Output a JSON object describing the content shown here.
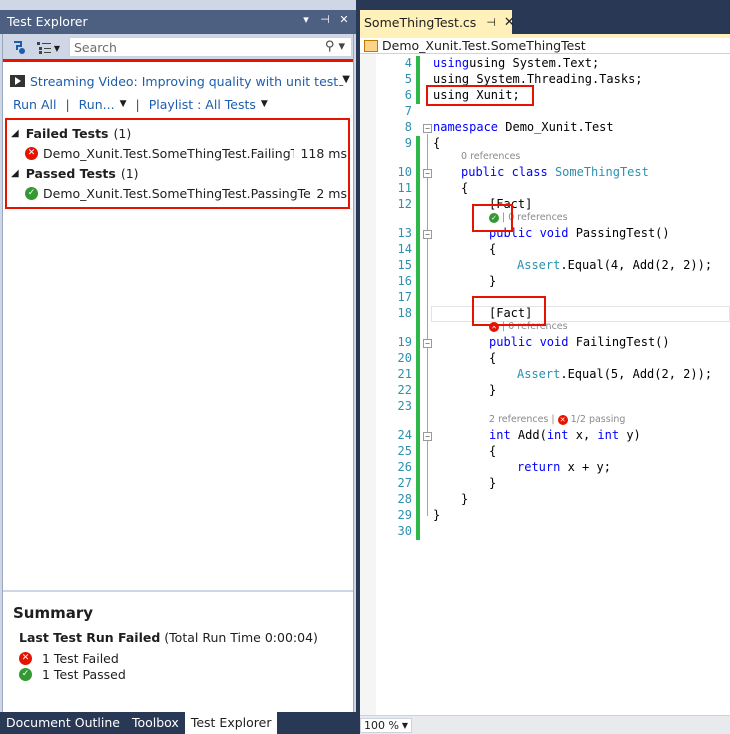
{
  "test_explorer": {
    "title": "Test Explorer",
    "title_buttons": [
      "▾",
      "⊣",
      "✕"
    ],
    "search_placeholder": "Search",
    "streaming_link": "Streaming Video: Improving quality with unit tests an",
    "actions": {
      "run_all": "Run All",
      "run": "Run...",
      "playlist": "Playlist : All Tests"
    },
    "groups": [
      {
        "label": "Failed Tests",
        "count": "(1)",
        "tests": [
          {
            "name": "Demo_Xunit.Test.SomeThingTest.FailingTest",
            "duration": "118 ms",
            "status": "fail"
          }
        ]
      },
      {
        "label": "Passed Tests",
        "count": "(1)",
        "tests": [
          {
            "name": "Demo_Xunit.Test.SomeThingTest.PassingTest",
            "duration": "2 ms",
            "status": "pass"
          }
        ]
      }
    ],
    "summary": {
      "heading": "Summary",
      "last_run": "Last Test Run Failed",
      "run_time": "(Total Run Time 0:00:04)",
      "failed": "1 Test Failed",
      "passed": "1 Test Passed"
    }
  },
  "bottom_tabs": [
    "Document Outline",
    "Toolbox",
    "Test Explorer"
  ],
  "editor": {
    "tab": "SomeThingTest.cs",
    "nav": "Demo_Xunit.Test.SomeThingTest",
    "zoom": "100 %",
    "line_numbers": [
      "4",
      "5",
      "6",
      "7",
      "8",
      "9",
      "10",
      "11",
      "12",
      "13",
      "14",
      "15",
      "16",
      "17",
      "18",
      "19",
      "20",
      "21",
      "22",
      "23",
      "24",
      "25",
      "26",
      "27",
      "28",
      "29",
      "30"
    ],
    "code": {
      "l4": "using System.Text;",
      "l5": "using System.Threading.Tasks;",
      "l6": "using Xunit;",
      "l8_ns": "namespace",
      "l8_name": " Demo_Xunit.Test",
      "l9": "{",
      "lens_class": "0 references",
      "l10_kw": "public class",
      "l10_type": "SomeThingTest",
      "l11": "{",
      "l12": "[Fact]",
      "lens_pass": "| 0 references",
      "l13_kw": "public void",
      "l13_rest": " PassingTest()",
      "l14": "{",
      "l15_type": "Assert",
      "l15_rest": ".Equal(4, Add(2, 2));",
      "l16": "}",
      "l18": "[Fact]",
      "lens_fail": "| 0 references",
      "l19_kw": "public void",
      "l19_rest": " FailingTest()",
      "l20": "{",
      "l21_type": "Assert",
      "l21_rest": ".Equal(5, Add(2, 2));",
      "l22": "}",
      "lens_add_refs": "2 references |",
      "lens_add_pass": "1/2 passing",
      "l24_kw1": "int",
      "l24_mid": " Add(",
      "l24_kw2": "int",
      "l24_x": " x, ",
      "l24_kw3": "int",
      "l24_y": " y)",
      "l25": "{",
      "l26_kw": "return",
      "l26_rest": " x + y;",
      "l27": "}",
      "l28": "}",
      "l29": "}"
    }
  }
}
